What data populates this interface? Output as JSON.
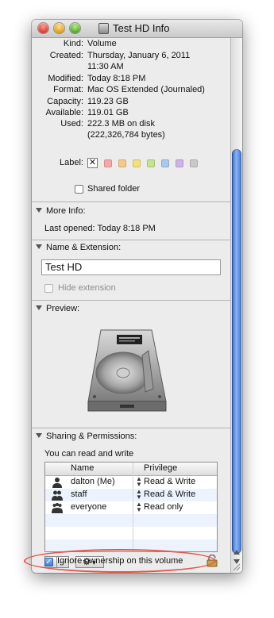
{
  "window": {
    "title": "Test HD Info",
    "title_icon": "drive-icon"
  },
  "general": [
    {
      "label": "Kind:",
      "value": "Volume"
    },
    {
      "label": "Created:",
      "value": "Thursday, January 6, 2011",
      "value2": "11:30 AM"
    },
    {
      "label": "Modified:",
      "value": "Today 8:18 PM"
    },
    {
      "label": "Format:",
      "value": "Mac OS Extended (Journaled)"
    },
    {
      "label": "Capacity:",
      "value": "119.23 GB"
    },
    {
      "label": "Available:",
      "value": "119.01 GB"
    },
    {
      "label": "Used:",
      "value": "222.3 MB on disk",
      "value2": "(222,326,784 bytes)"
    }
  ],
  "label_row": {
    "label": "Label:",
    "colors": [
      "#f7a8a4",
      "#f7c987",
      "#f3e07d",
      "#c2e58e",
      "#a9c9ec",
      "#d1b2e6",
      "#c9c9c9"
    ]
  },
  "shared_folder": {
    "label": "Shared folder",
    "checked": false
  },
  "more_info": {
    "header": "More Info:",
    "last_opened": "Last opened: Today 8:18 PM"
  },
  "name_ext": {
    "header": "Name & Extension:",
    "name_value": "Test HD",
    "hide_extension": "Hide extension"
  },
  "preview": {
    "header": "Preview:"
  },
  "sharing": {
    "header": "Sharing & Permissions:",
    "summary": "You can read and write",
    "columns": [
      "Name",
      "Privilege"
    ],
    "rows": [
      {
        "name": "dalton (Me)",
        "privilege": "Read & Write",
        "icon": "single-user-icon"
      },
      {
        "name": "staff",
        "privilege": "Read & Write",
        "icon": "group-icon"
      },
      {
        "name": "everyone",
        "privilege": "Read only",
        "icon": "everyone-icon"
      }
    ],
    "add": "+",
    "remove": "−"
  },
  "ignore_ownership": {
    "label": "Ignore ownership on this volume",
    "checked": true
  },
  "colors": {
    "highlight": "#e2584c",
    "scroll_thumb": "#3f77d6"
  }
}
